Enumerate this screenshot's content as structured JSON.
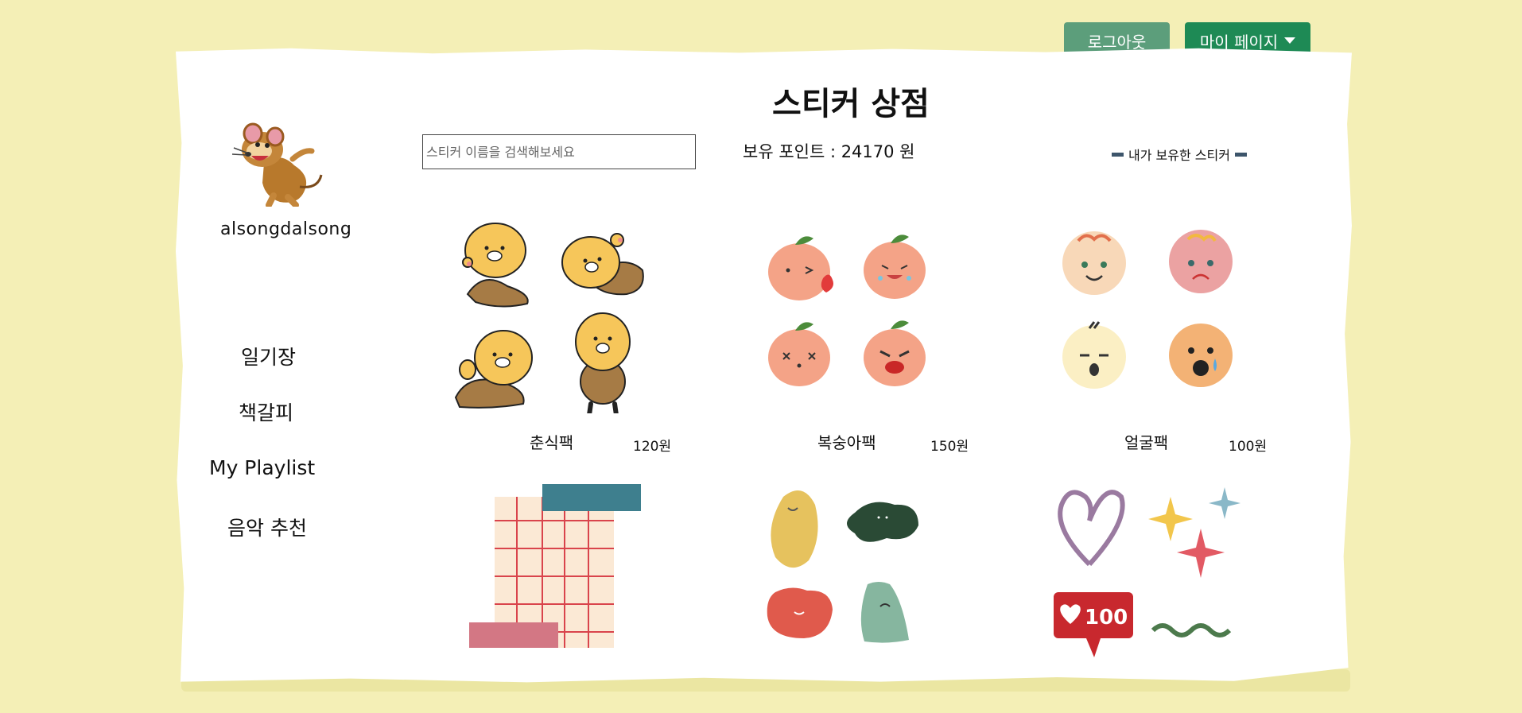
{
  "header": {
    "logout_label": "로그아웃",
    "mypage_label": "마이 페이지"
  },
  "page": {
    "title": "스티커 상점"
  },
  "profile": {
    "username": "alsongdalsong"
  },
  "nav": {
    "items": [
      "일기장",
      "책갈피",
      "My Playlist",
      "음악 추천"
    ]
  },
  "search": {
    "placeholder": "스티커 이름을 검색해보세요",
    "value": ""
  },
  "points": {
    "label": "보유 포인트 : 24170 원"
  },
  "owned_toggle": {
    "label": "내가 보유한 스티커"
  },
  "packs": [
    {
      "name": "춘식팩",
      "price": "120원"
    },
    {
      "name": "복숭아팩",
      "price": "150원"
    },
    {
      "name": "얼굴팩",
      "price": "100원"
    }
  ],
  "colors": {
    "background": "#f4efb6",
    "logout": "#5c9e7b",
    "mypage": "#1e8a55",
    "peach": "#f4a387",
    "chunsik": "#f6c65a"
  }
}
